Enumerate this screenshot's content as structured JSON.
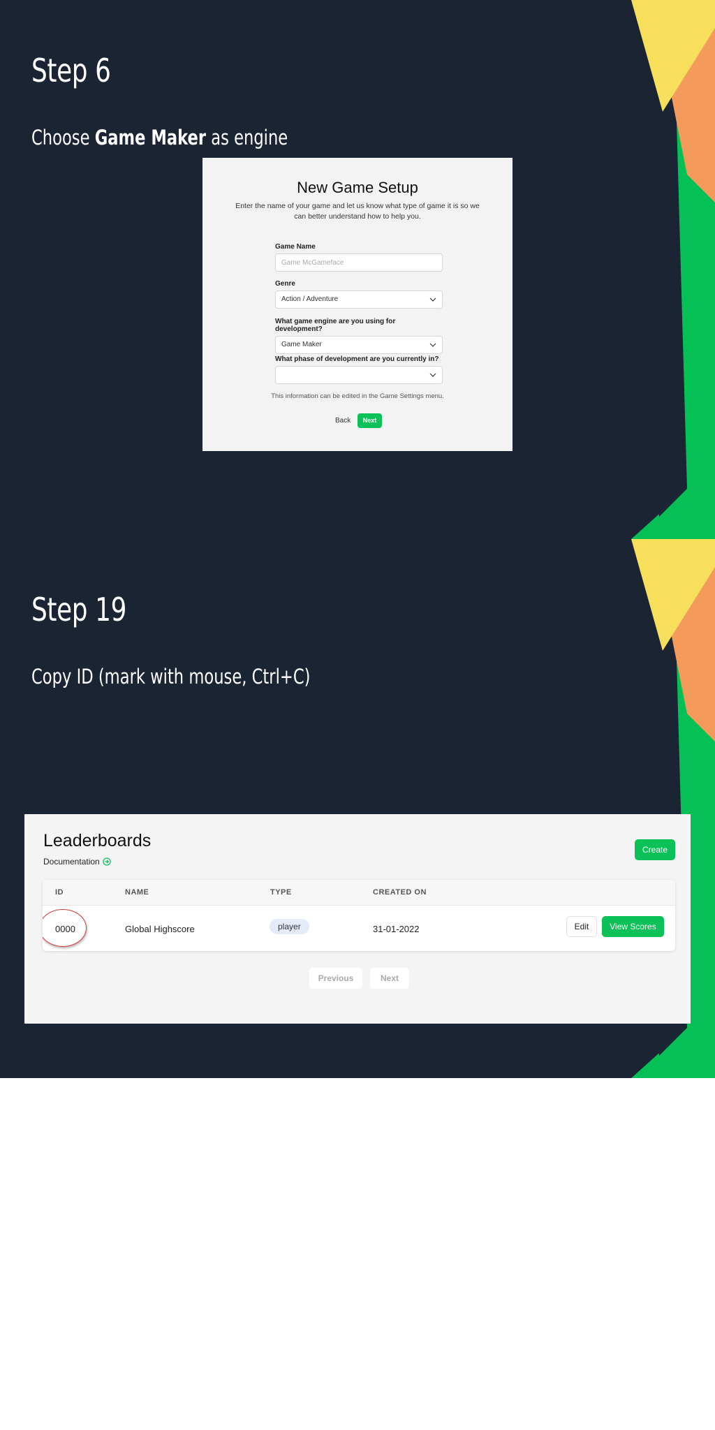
{
  "colors": {
    "background": "#1b2433",
    "accent_green": "#0cc157",
    "decor_yellow": "#f7df5b",
    "decor_orange": "#f49a5a",
    "decor_green": "#05c155",
    "circle_red": "#d43a3a"
  },
  "step6": {
    "title": "Step 6",
    "desc_prefix": "Choose ",
    "desc_bold": "Game Maker",
    "desc_suffix": " as engine",
    "setup": {
      "title": "New Game Setup",
      "subtitle": "Enter the name of your game and let us know what type of game it is so we can better understand how to help you.",
      "game_name_label": "Game Name",
      "game_name_placeholder": "Game McGameface",
      "genre_label": "Genre",
      "genre_value": "Action / Adventure",
      "engine_label": "What game engine are you using for development?",
      "engine_value": "Game Maker",
      "phase_label": "What phase of development are you currently in?",
      "phase_value": "",
      "note": "This information can be edited in the Game Settings menu.",
      "back_label": "Back",
      "next_label": "Next"
    }
  },
  "step19": {
    "title": "Step 19",
    "desc": "Copy ID (mark with mouse, Ctrl+C)",
    "leaderboards": {
      "title": "Leaderboards",
      "documentation_label": "Documentation",
      "create_label": "Create",
      "columns": [
        "ID",
        "NAME",
        "TYPE",
        "CREATED ON"
      ],
      "rows": [
        {
          "id": "0000",
          "name": "Global Highscore",
          "type": "player",
          "created_on": "31-01-2022"
        }
      ],
      "edit_label": "Edit",
      "view_scores_label": "View Scores",
      "previous_label": "Previous",
      "next_label": "Next"
    }
  }
}
